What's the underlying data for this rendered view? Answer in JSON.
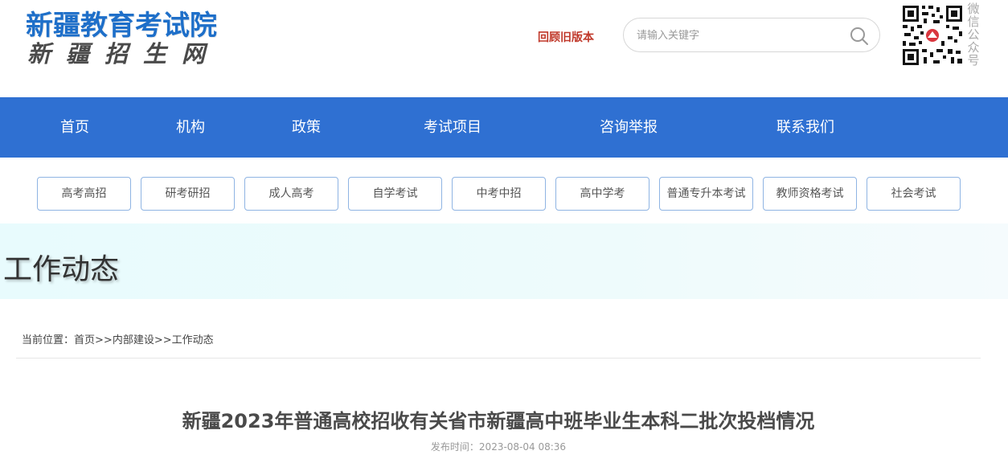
{
  "header": {
    "logo_title": "新疆教育考试院",
    "logo_subtitle": "新疆招生网",
    "old_version_link": "回顾旧版本",
    "search_placeholder": "请输入关键字",
    "qr_label": "微信公众号"
  },
  "nav": {
    "items": [
      {
        "label": "首页"
      },
      {
        "label": "机构"
      },
      {
        "label": "政策"
      },
      {
        "label": "考试项目"
      },
      {
        "label": "咨询举报"
      },
      {
        "label": "联系我们"
      }
    ]
  },
  "categories": [
    {
      "label": "高考高招"
    },
    {
      "label": "研考研招"
    },
    {
      "label": "成人高考"
    },
    {
      "label": "自学考试"
    },
    {
      "label": "中考中招"
    },
    {
      "label": "高中学考"
    },
    {
      "label": "普通专升本考试"
    },
    {
      "label": "教师资格考试"
    },
    {
      "label": "社会考试"
    }
  ],
  "banner": {
    "title": "工作动态"
  },
  "breadcrumb": {
    "prefix": "当前位置：",
    "items": [
      "首页",
      "内部建设",
      "工作动态"
    ],
    "separator": ">>"
  },
  "article": {
    "title": "新疆2023年普通高校招收有关省市新疆高中班毕业生本科二批次投档情况",
    "published": "发布时间：2023-08-04 08:36"
  },
  "colors": {
    "brand_blue": "#2f70d2",
    "logo_blue": "#1e6fc9",
    "old_version_red": "#c0392b"
  }
}
